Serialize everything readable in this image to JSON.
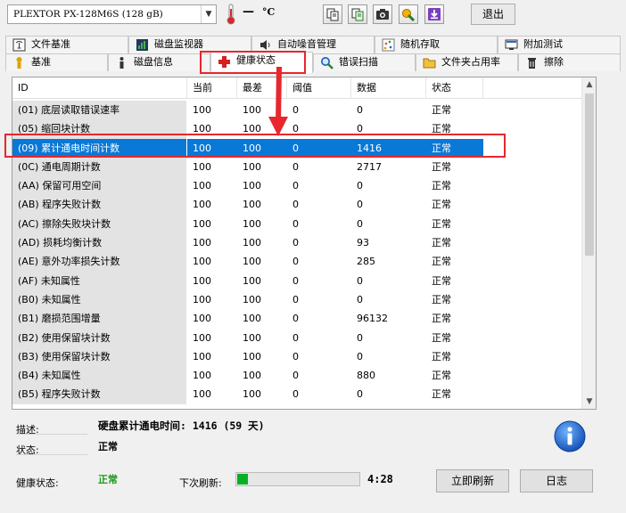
{
  "toolbar": {
    "drive": "PLEXTOR PX-128M6S (128 gB)",
    "temperature": "—",
    "temperature_unit": "°C",
    "exit_label": "退出"
  },
  "tabs": {
    "row1": [
      {
        "label": "文件基准",
        "icon": "file-benchmark-icon"
      },
      {
        "label": "磁盘监视器",
        "icon": "disk-monitor-icon"
      },
      {
        "label": "自动噪音管理",
        "icon": "speaker-icon"
      },
      {
        "label": "随机存取",
        "icon": "random-access-icon"
      },
      {
        "label": "附加测试",
        "icon": "extra-tests-icon"
      }
    ],
    "row2": [
      {
        "label": "基准",
        "icon": "benchmark-icon"
      },
      {
        "label": "磁盘信息",
        "icon": "disk-info-icon"
      },
      {
        "label": "健康状态",
        "icon": "health-cross-icon",
        "active": true
      },
      {
        "label": "错误扫描",
        "icon": "magnifier-icon"
      },
      {
        "label": "文件夹占用率",
        "icon": "folder-icon"
      },
      {
        "label": "擦除",
        "icon": "erase-icon"
      }
    ]
  },
  "table": {
    "columns": [
      "ID",
      "当前",
      "最差",
      "阈值",
      "数据",
      "状态"
    ],
    "selected_index": 2,
    "rows": [
      [
        "(01) 底层读取错误速率",
        "100",
        "100",
        "0",
        "0",
        "正常"
      ],
      [
        "(05) 缩回块计数",
        "100",
        "100",
        "0",
        "0",
        "正常"
      ],
      [
        "(09) 累计通电时间计数",
        "100",
        "100",
        "0",
        "1416",
        "正常"
      ],
      [
        "(0C) 通电周期计数",
        "100",
        "100",
        "0",
        "2717",
        "正常"
      ],
      [
        "(AA) 保留可用空间",
        "100",
        "100",
        "0",
        "0",
        "正常"
      ],
      [
        "(AB) 程序失败计数",
        "100",
        "100",
        "0",
        "0",
        "正常"
      ],
      [
        "(AC) 擦除失败块计数",
        "100",
        "100",
        "0",
        "0",
        "正常"
      ],
      [
        "(AD) 损耗均衡计数",
        "100",
        "100",
        "0",
        "93",
        "正常"
      ],
      [
        "(AE) 意外功率损失计数",
        "100",
        "100",
        "0",
        "285",
        "正常"
      ],
      [
        "(AF) 未知属性",
        "100",
        "100",
        "0",
        "0",
        "正常"
      ],
      [
        "(B0) 未知属性",
        "100",
        "100",
        "0",
        "0",
        "正常"
      ],
      [
        "(B1) 磨损范围增量",
        "100",
        "100",
        "0",
        "96132",
        "正常"
      ],
      [
        "(B2) 使用保留块计数",
        "100",
        "100",
        "0",
        "0",
        "正常"
      ],
      [
        "(B3) 使用保留块计数",
        "100",
        "100",
        "0",
        "0",
        "正常"
      ],
      [
        "(B4) 未知属性",
        "100",
        "100",
        "0",
        "880",
        "正常"
      ],
      [
        "(B5) 程序失败计数",
        "100",
        "100",
        "0",
        "0",
        "正常"
      ]
    ]
  },
  "status": {
    "description_label": "描述:",
    "description_value": "硬盘累计通电时间: 1416 (59 天)",
    "state_label": "状态:",
    "state_value": "正常",
    "health_label": "健康状态:",
    "health_value": "正常",
    "next_refresh_label": "下次刷新:",
    "refresh_progress": 0.09,
    "countdown": "4:28",
    "refresh_button": "立即刷新",
    "log_button": "日志"
  },
  "colors": {
    "selection": "#0a78d7",
    "highlight_red": "#e8262d",
    "health_green": "#1b9a1b",
    "progress_green": "#06b025"
  }
}
